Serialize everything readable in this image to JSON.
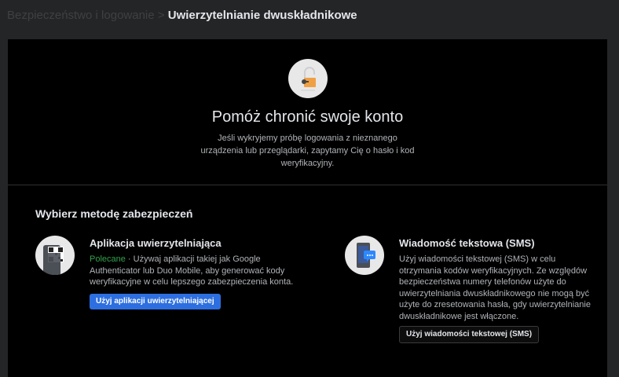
{
  "breadcrumb": {
    "parent": "Bezpieczeństwo i logowanie",
    "separator": " > ",
    "current": "Uwierzytelnianie dwuskładnikowe"
  },
  "hero": {
    "icon": "padlock-key-icon",
    "title": "Pomóż chronić swoje konto",
    "description": "Jeśli wykryjemy próbę logowania z nieznanego urządzenia lub przeglądarki, zapytamy Cię o hasło i kod weryfikacyjny."
  },
  "section_title": "Wybierz metodę zabezpieczeń",
  "methods": [
    {
      "icon": "qr-phone-icon",
      "title": "Aplikacja uwierzytelniająca",
      "badge": "Polecane",
      "badge_color": "#31a24c",
      "description": " · Używaj aplikacji takiej jak Google Authenticator lub Duo Mobile, aby generować kody weryfikacyjne w celu lepszego zabezpieczenia konta.",
      "button": "Użyj aplikacji uwierzytelniającej"
    },
    {
      "icon": "phone-message-icon",
      "title": "Wiadomość tekstowa (SMS)",
      "description": "Użyj wiadomości tekstowej (SMS) w celu otrzymania kodów weryfikacyjnych. Ze względów bezpieczeństwa numery telefonów użyte do uwierzytelniania dwuskładnikowego nie mogą być użyte do zresetowania hasła, gdy uwierzytelnianie dwuskładnikowe jest włączone.",
      "button": "Użyj wiadomości tekstowej (SMS)"
    }
  ],
  "colors": {
    "accent": "#2d6fe0",
    "lock": "#f0a044"
  }
}
